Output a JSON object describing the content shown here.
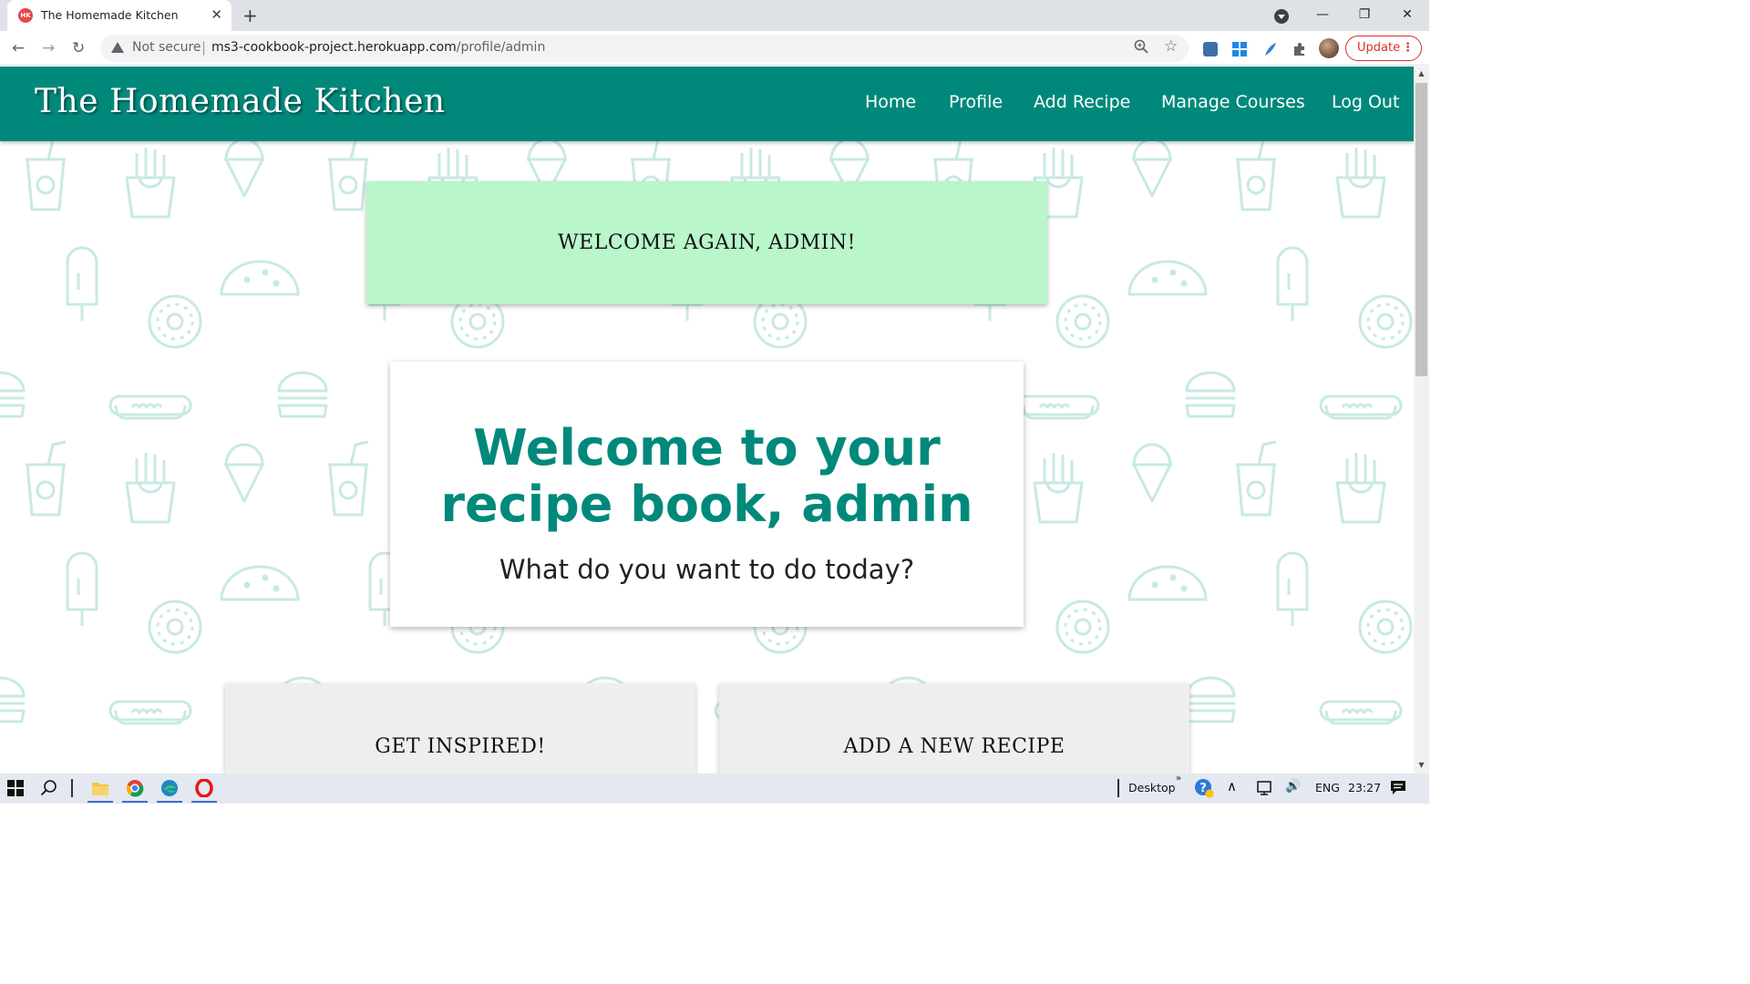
{
  "browser": {
    "tab_title": "The Homemade Kitchen",
    "tab_favicon_text": "HK",
    "security_label": "Not secure",
    "url_host": "ms3-cookbook-project.herokuapp.com",
    "url_path": "/profile/admin",
    "update_label": "Update"
  },
  "site": {
    "brand": "The Homemade Kitchen",
    "nav": [
      "Home",
      "Profile",
      "Add Recipe",
      "Manage Courses",
      "Log Out"
    ]
  },
  "main": {
    "welcome_banner": "WELCOME AGAIN, ADMIN!",
    "hero_title": "Welcome to your recipe book, admin",
    "hero_subtitle": "What do you want to do today?",
    "cards": [
      "GET INSPIRED!",
      "ADD A NEW RECIPE"
    ]
  },
  "taskbar": {
    "desktop_label": "Desktop",
    "language": "ENG",
    "time": "23:27"
  },
  "colors": {
    "nav_teal": "#00897b",
    "banner_green": "#b9f6ca",
    "pattern_teal": "#c8e9e4",
    "update_red": "#d93025"
  },
  "icons": {
    "pattern": [
      "soda-cup-icon",
      "fries-icon",
      "ice-cream-cone-icon",
      "burger-icon",
      "hotdog-icon",
      "taco-icon",
      "popsicle-icon",
      "donut-icon"
    ],
    "browser": [
      "back-arrow-icon",
      "forward-arrow-icon",
      "reload-icon",
      "warning-triangle-icon",
      "zoom-icon",
      "bookmark-star-icon",
      "extensions-puzzle-icon"
    ],
    "taskbar": [
      "windows-start-icon",
      "search-icon",
      "file-explorer-icon",
      "chrome-icon",
      "edge-icon",
      "opera-icon",
      "help-icon",
      "chevron-up-icon",
      "network-icon",
      "volume-icon",
      "notifications-icon"
    ]
  }
}
